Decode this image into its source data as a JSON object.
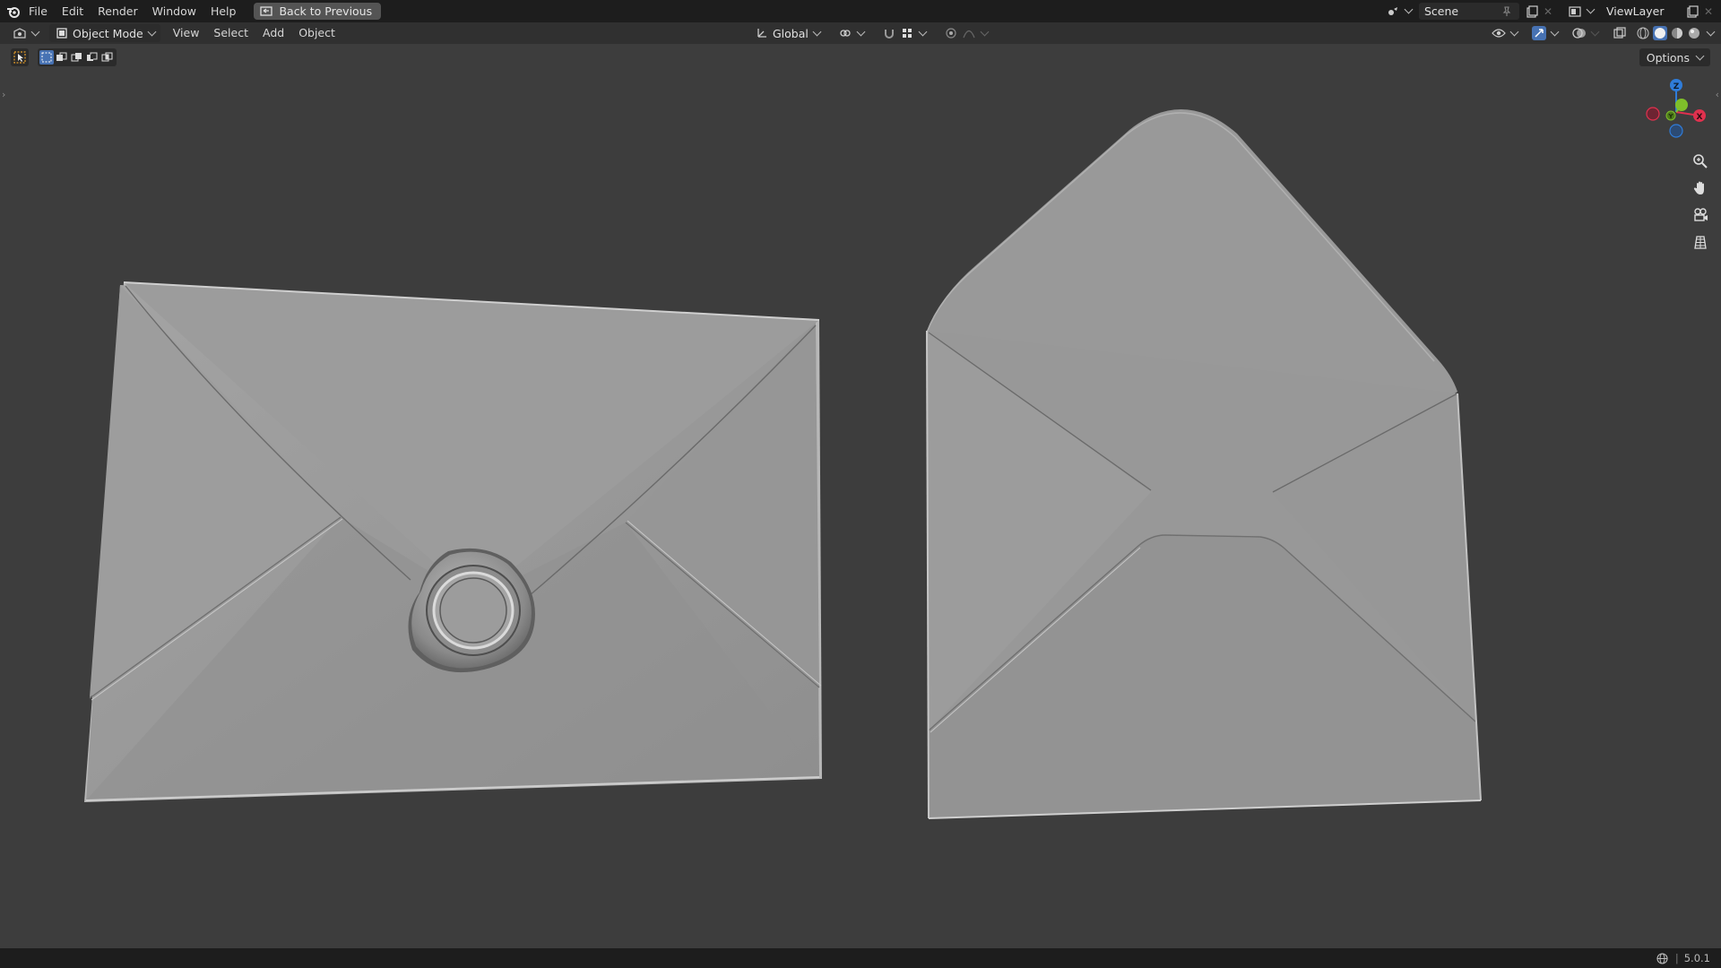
{
  "topbar": {
    "menus": [
      "File",
      "Edit",
      "Render",
      "Window",
      "Help"
    ],
    "back_button": "Back to Previous",
    "scene_name": "Scene",
    "view_layer_name": "ViewLayer"
  },
  "viewport_header": {
    "mode": "Object Mode",
    "menus": [
      "View",
      "Select",
      "Add",
      "Object"
    ],
    "transform_orientation": "Global"
  },
  "viewport": {
    "options_label": "Options",
    "gizmo_axes": [
      "Z",
      "Y",
      "X"
    ],
    "nav_icons": [
      "zoom-icon",
      "pan-hand-icon",
      "camera-icon",
      "grid-ortho-icon"
    ],
    "objects": [
      "envelope-closed-with-wax-seal",
      "envelope-open-flap"
    ]
  },
  "statusbar": {
    "version": "5.0.1"
  },
  "colors": {
    "topbar": "#1d1d1d",
    "header": "#303030",
    "viewport": "#3d3d3d",
    "axis_x": "#e0314e",
    "axis_y": "#7fbf2a",
    "axis_z": "#2f7cd9"
  }
}
